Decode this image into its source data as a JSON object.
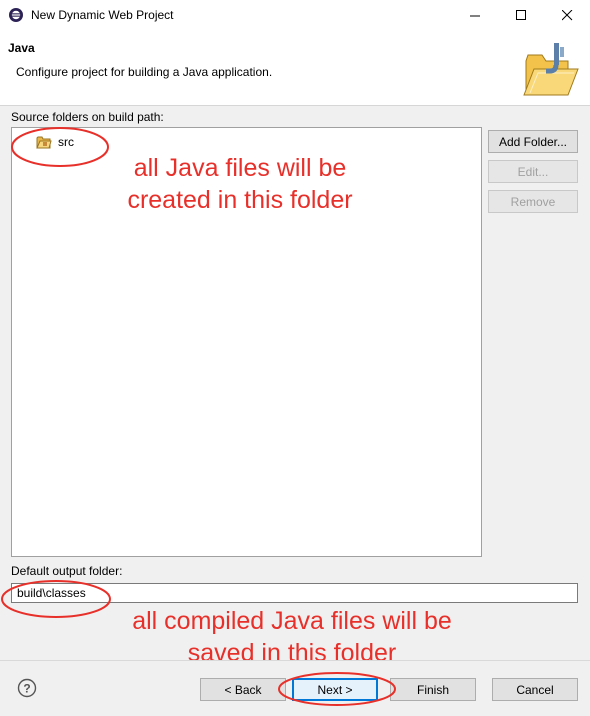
{
  "window": {
    "title": "New Dynamic Web Project"
  },
  "page_header": {
    "title": "Java",
    "description": "Configure project for building a Java application."
  },
  "source": {
    "label": "Source folders on build path:",
    "items": [
      {
        "label": "src",
        "icon": "package-folder-icon"
      }
    ],
    "buttons": {
      "add": "Add Folder...",
      "edit": "Edit...",
      "remove": "Remove"
    }
  },
  "output": {
    "label": "Default output folder:",
    "value": "build\\classes"
  },
  "annotations": {
    "source_line1": "all Java files will be",
    "source_line2": "created in this folder",
    "output_line1": "all compiled Java files will be",
    "output_line2": "saved in this folder",
    "color": "#e8302a"
  },
  "footer": {
    "back": "< Back",
    "next": "Next >",
    "finish": "Finish",
    "cancel": "Cancel"
  },
  "colors": {
    "accent": "#0078d7",
    "annotation": "#e8302a"
  }
}
